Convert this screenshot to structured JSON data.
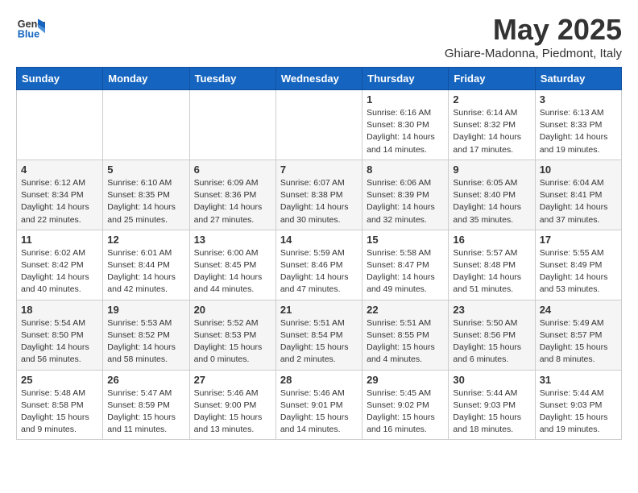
{
  "header": {
    "logo_general": "General",
    "logo_blue": "Blue",
    "title": "May 2025",
    "location": "Ghiare-Madonna, Piedmont, Italy"
  },
  "weekdays": [
    "Sunday",
    "Monday",
    "Tuesday",
    "Wednesday",
    "Thursday",
    "Friday",
    "Saturday"
  ],
  "weeks": [
    [
      {
        "day": "",
        "info": ""
      },
      {
        "day": "",
        "info": ""
      },
      {
        "day": "",
        "info": ""
      },
      {
        "day": "",
        "info": ""
      },
      {
        "day": "1",
        "info": "Sunrise: 6:16 AM\nSunset: 8:30 PM\nDaylight: 14 hours\nand 14 minutes."
      },
      {
        "day": "2",
        "info": "Sunrise: 6:14 AM\nSunset: 8:32 PM\nDaylight: 14 hours\nand 17 minutes."
      },
      {
        "day": "3",
        "info": "Sunrise: 6:13 AM\nSunset: 8:33 PM\nDaylight: 14 hours\nand 19 minutes."
      }
    ],
    [
      {
        "day": "4",
        "info": "Sunrise: 6:12 AM\nSunset: 8:34 PM\nDaylight: 14 hours\nand 22 minutes."
      },
      {
        "day": "5",
        "info": "Sunrise: 6:10 AM\nSunset: 8:35 PM\nDaylight: 14 hours\nand 25 minutes."
      },
      {
        "day": "6",
        "info": "Sunrise: 6:09 AM\nSunset: 8:36 PM\nDaylight: 14 hours\nand 27 minutes."
      },
      {
        "day": "7",
        "info": "Sunrise: 6:07 AM\nSunset: 8:38 PM\nDaylight: 14 hours\nand 30 minutes."
      },
      {
        "day": "8",
        "info": "Sunrise: 6:06 AM\nSunset: 8:39 PM\nDaylight: 14 hours\nand 32 minutes."
      },
      {
        "day": "9",
        "info": "Sunrise: 6:05 AM\nSunset: 8:40 PM\nDaylight: 14 hours\nand 35 minutes."
      },
      {
        "day": "10",
        "info": "Sunrise: 6:04 AM\nSunset: 8:41 PM\nDaylight: 14 hours\nand 37 minutes."
      }
    ],
    [
      {
        "day": "11",
        "info": "Sunrise: 6:02 AM\nSunset: 8:42 PM\nDaylight: 14 hours\nand 40 minutes."
      },
      {
        "day": "12",
        "info": "Sunrise: 6:01 AM\nSunset: 8:44 PM\nDaylight: 14 hours\nand 42 minutes."
      },
      {
        "day": "13",
        "info": "Sunrise: 6:00 AM\nSunset: 8:45 PM\nDaylight: 14 hours\nand 44 minutes."
      },
      {
        "day": "14",
        "info": "Sunrise: 5:59 AM\nSunset: 8:46 PM\nDaylight: 14 hours\nand 47 minutes."
      },
      {
        "day": "15",
        "info": "Sunrise: 5:58 AM\nSunset: 8:47 PM\nDaylight: 14 hours\nand 49 minutes."
      },
      {
        "day": "16",
        "info": "Sunrise: 5:57 AM\nSunset: 8:48 PM\nDaylight: 14 hours\nand 51 minutes."
      },
      {
        "day": "17",
        "info": "Sunrise: 5:55 AM\nSunset: 8:49 PM\nDaylight: 14 hours\nand 53 minutes."
      }
    ],
    [
      {
        "day": "18",
        "info": "Sunrise: 5:54 AM\nSunset: 8:50 PM\nDaylight: 14 hours\nand 56 minutes."
      },
      {
        "day": "19",
        "info": "Sunrise: 5:53 AM\nSunset: 8:52 PM\nDaylight: 14 hours\nand 58 minutes."
      },
      {
        "day": "20",
        "info": "Sunrise: 5:52 AM\nSunset: 8:53 PM\nDaylight: 15 hours\nand 0 minutes."
      },
      {
        "day": "21",
        "info": "Sunrise: 5:51 AM\nSunset: 8:54 PM\nDaylight: 15 hours\nand 2 minutes."
      },
      {
        "day": "22",
        "info": "Sunrise: 5:51 AM\nSunset: 8:55 PM\nDaylight: 15 hours\nand 4 minutes."
      },
      {
        "day": "23",
        "info": "Sunrise: 5:50 AM\nSunset: 8:56 PM\nDaylight: 15 hours\nand 6 minutes."
      },
      {
        "day": "24",
        "info": "Sunrise: 5:49 AM\nSunset: 8:57 PM\nDaylight: 15 hours\nand 8 minutes."
      }
    ],
    [
      {
        "day": "25",
        "info": "Sunrise: 5:48 AM\nSunset: 8:58 PM\nDaylight: 15 hours\nand 9 minutes."
      },
      {
        "day": "26",
        "info": "Sunrise: 5:47 AM\nSunset: 8:59 PM\nDaylight: 15 hours\nand 11 minutes."
      },
      {
        "day": "27",
        "info": "Sunrise: 5:46 AM\nSunset: 9:00 PM\nDaylight: 15 hours\nand 13 minutes."
      },
      {
        "day": "28",
        "info": "Sunrise: 5:46 AM\nSunset: 9:01 PM\nDaylight: 15 hours\nand 14 minutes."
      },
      {
        "day": "29",
        "info": "Sunrise: 5:45 AM\nSunset: 9:02 PM\nDaylight: 15 hours\nand 16 minutes."
      },
      {
        "day": "30",
        "info": "Sunrise: 5:44 AM\nSunset: 9:03 PM\nDaylight: 15 hours\nand 18 minutes."
      },
      {
        "day": "31",
        "info": "Sunrise: 5:44 AM\nSunset: 9:03 PM\nDaylight: 15 hours\nand 19 minutes."
      }
    ]
  ]
}
